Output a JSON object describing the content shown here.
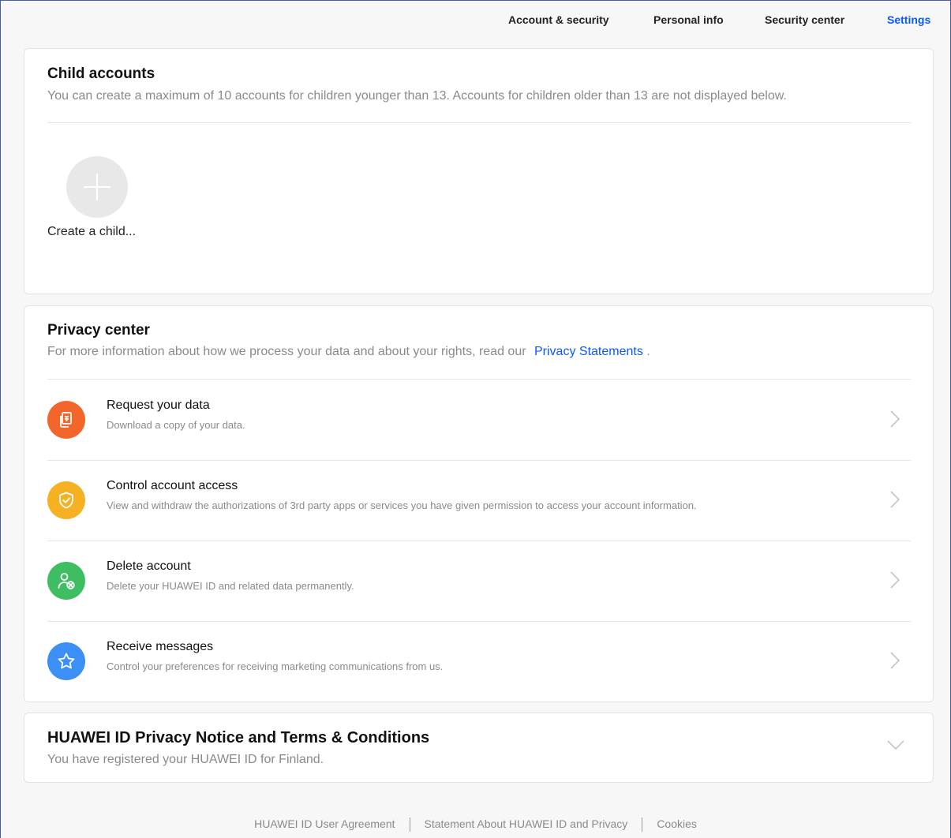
{
  "nav": {
    "items": [
      {
        "label": "Account & security",
        "active": false
      },
      {
        "label": "Personal info",
        "active": false
      },
      {
        "label": "Security center",
        "active": false
      },
      {
        "label": "Settings",
        "active": true
      }
    ]
  },
  "child_accounts": {
    "title": "Child accounts",
    "subtitle": "You can create a maximum of 10 accounts for children younger than 13. Accounts for children older than 13 are not displayed below.",
    "create_label": "Create a child..."
  },
  "privacy": {
    "title": "Privacy center",
    "subtitle_prefix": "For more information about how we process your data and about your rights, read our",
    "subtitle_link": "Privacy Statements",
    "subtitle_suffix": ".",
    "rows": [
      {
        "title": "Request your data",
        "desc": "Download a copy of your data.",
        "icon": "document-copy-icon",
        "color": "#f2662c"
      },
      {
        "title": "Control account access",
        "desc": "View and withdraw the authorizations of 3rd party apps or services you have given permission to access your account information.",
        "icon": "shield-check-icon",
        "color": "#f6b122"
      },
      {
        "title": "Delete account",
        "desc": "Delete your HUAWEI ID and related data permanently.",
        "icon": "user-remove-icon",
        "color": "#3fbd62"
      },
      {
        "title": "Receive messages",
        "desc": "Control your preferences for receiving marketing communications from us.",
        "icon": "star-icon",
        "color": "#3c8ff5"
      }
    ]
  },
  "terms": {
    "title": "HUAWEI ID Privacy Notice and Terms & Conditions",
    "subtitle": "You have registered your HUAWEI ID for Finland."
  },
  "footer": {
    "links": [
      "HUAWEI ID User Agreement",
      "Statement About HUAWEI ID and Privacy",
      "Cookies"
    ]
  },
  "colors": {
    "accent": "#0a59f7"
  }
}
